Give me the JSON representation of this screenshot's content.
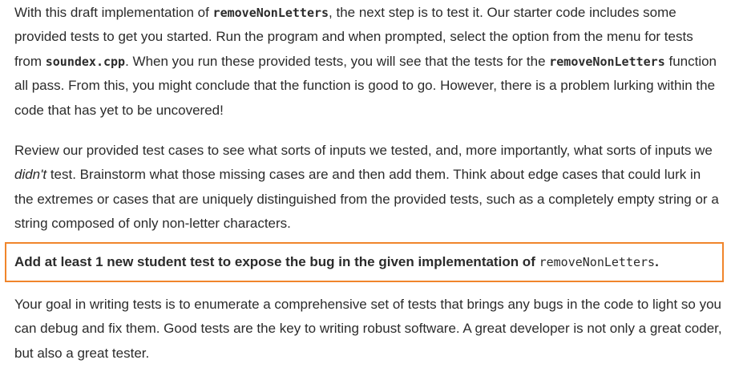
{
  "paragraph1": {
    "t1": "With this draft implementation of ",
    "c1": "removeNonLetters",
    "t2": ", the next step is to test it. Our starter code includes some provided tests to get you started. Run the program and when prompted, select the option from the menu for tests from ",
    "c2": "soundex.cpp",
    "t3": ". When you run these provided tests, you will see that the tests for the ",
    "c3": "removeNonLetters",
    "t4": " function all pass. From this, you might conclude that the function is good to go. However, there is a problem lurking within the code that has yet to be uncovered!"
  },
  "paragraph2": {
    "t1": "Review our provided test cases to see what sorts of inputs we tested, and, more importantly, what sorts of inputs we ",
    "em": "didn't",
    "t2": " test. Brainstorm what those missing cases are and then add them. Think about edge cases that could lurk in the extremes or cases that are uniquely distinguished from the provided tests, such as a completely empty string or a string composed of only non-letter characters."
  },
  "callout": {
    "text": "Add at least 1 new student test to expose the bug in the given implementation of ",
    "code": "removeNonLetters",
    "end": ".",
    "border_color": "#f0852b"
  },
  "paragraph3": {
    "text": "Your goal in writing tests is to enumerate a comprehensive set of tests that brings any bugs in the code to light so you can debug and fix them. Good tests are the key to writing robust software. A great developer is not only a great coder, but also a great tester."
  }
}
